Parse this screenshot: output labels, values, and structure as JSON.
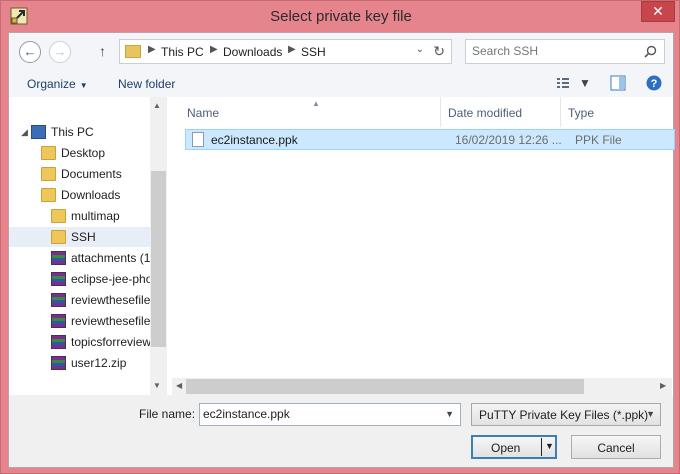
{
  "window": {
    "title": "Select private key file",
    "close_glyph": "✕"
  },
  "nav": {
    "back_glyph": "←",
    "forward_glyph": "→",
    "up_glyph": "↑",
    "breadcrumbs": [
      "This PC",
      "Downloads",
      "SSH"
    ],
    "crumb_sep": "▶",
    "dropdown_glyph": "⌄",
    "refresh_glyph": "↻"
  },
  "search": {
    "placeholder": "Search SSH",
    "icon": "search-icon"
  },
  "commands": {
    "organize": "Organize",
    "organize_caret": "▼",
    "new_folder": "New folder"
  },
  "tree": {
    "items": [
      {
        "label": "This PC",
        "icon": "computer-icon"
      },
      {
        "label": "Desktop",
        "icon": "folder-icon"
      },
      {
        "label": "Documents",
        "icon": "folder-icon"
      },
      {
        "label": "Downloads",
        "icon": "folder-icon"
      },
      {
        "label": "multimap",
        "icon": "folder-icon"
      },
      {
        "label": "SSH",
        "icon": "folder-icon",
        "selected": true
      },
      {
        "label": "attachments (1",
        "icon": "zip-icon"
      },
      {
        "label": "eclipse-jee-pho",
        "icon": "zip-icon"
      },
      {
        "label": "reviewthesefile",
        "icon": "zip-icon"
      },
      {
        "label": "reviewthesefile",
        "icon": "zip-icon"
      },
      {
        "label": "topicsforreview",
        "icon": "zip-icon"
      },
      {
        "label": "user12.zip",
        "icon": "zip-icon"
      }
    ]
  },
  "list": {
    "columns": [
      "Name",
      "Date modified",
      "Type"
    ],
    "sort_glyph": "▲",
    "files": [
      {
        "name": "ec2instance.ppk",
        "date": "16/02/2019 12:26 ...",
        "type": "PPK File"
      }
    ]
  },
  "scroll": {
    "up": "▲",
    "down": "▼",
    "left": "◀",
    "right": "▶"
  },
  "bottom": {
    "file_name_label": "File name:",
    "file_name_value": "ec2instance.ppk",
    "file_type": "PuTTY Private Key Files (*.ppk)",
    "caret": "▼",
    "open": "Open",
    "cancel": "Cancel"
  },
  "colors": {
    "accent": "#3c7fb1",
    "selection": "#cce8ff",
    "title_bar": "#e6848e",
    "close": "#c7464c"
  }
}
